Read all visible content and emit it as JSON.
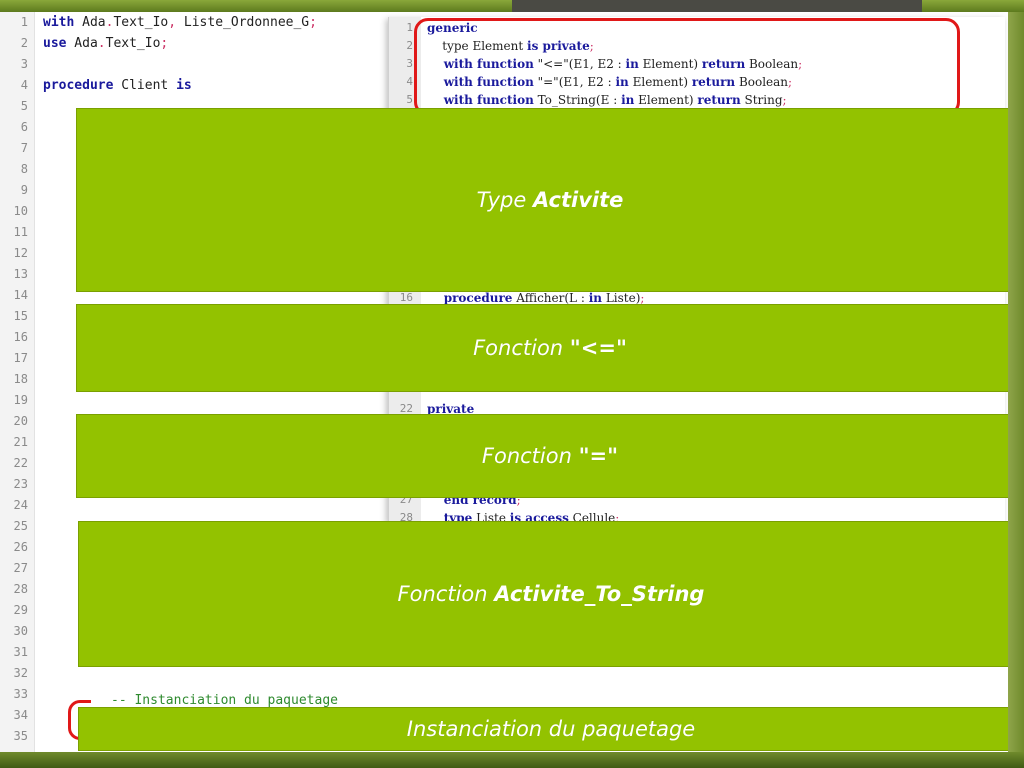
{
  "main_code": {
    "line_numbers": [
      "1",
      "2",
      "3",
      "4",
      "5",
      "6",
      "7",
      "8",
      "9",
      "10",
      "11",
      "12",
      "13",
      "14",
      "15",
      "16",
      "17",
      "18",
      "19",
      "20",
      "21",
      "22",
      "23",
      "24",
      "25",
      "26",
      "27",
      "28",
      "29",
      "30",
      "31",
      "32",
      "33",
      "34",
      "35"
    ],
    "line1_kw": "with",
    "line1_rest": " Ada",
    "line1_dot": ".",
    "line1_rest2": "Text_Io",
    "line1_comma": ",",
    "line1_rest3": " Liste_Ordonnee_G",
    "line1_semi": ";",
    "line2_kw": "use",
    "line2_rest": " Ada",
    "line2_dot": ".",
    "line2_rest2": "Text_Io",
    "line2_semi": ";",
    "line4_kw": "procedure",
    "line4_rest": " Client ",
    "line4_kw2": "is",
    "line33_comment": "-- Instanciation du paquetage"
  },
  "package_spec": {
    "line_numbers": [
      "1",
      "2",
      "3",
      "4",
      "5",
      "16",
      "22",
      "27",
      "28"
    ],
    "l1_kw": "generic",
    "l2_a": "    type Element ",
    "l2_kw": "is private",
    "l2_semi": ";",
    "l3_kw": "    with function",
    "l3_a": " \"<=\"",
    "l3_p": "(E1, E2 : ",
    "l3_in": "in",
    "l3_b": " Element) ",
    "l3_ret": "return",
    "l3_c": " Boolean",
    "l3_semi": ";",
    "l4_kw": "    with function",
    "l4_a": " \"=\"",
    "l4_p": "(E1, E2 : ",
    "l4_in": "in",
    "l4_b": " Element) ",
    "l4_ret": "return",
    "l4_c": " Boolean",
    "l4_semi": ";",
    "l5_kw": "    with function",
    "l5_a": " To_String(E : ",
    "l5_in": "in",
    "l5_b": " Element) ",
    "l5_ret": "return",
    "l5_c": " String",
    "l5_semi": ";",
    "l16_kw": "    procedure",
    "l16_a": " Afficher(L : ",
    "l16_in": "in",
    "l16_b": " Liste)",
    "l16_semi": ";",
    "l22_kw": "private",
    "l27_kw": "    end record",
    "l27_semi": ";",
    "l28_kw": "    type",
    "l28_a": " Liste ",
    "l28_kw2": "is access",
    "l28_b": " Cellule",
    "l28_semi": ";"
  },
  "overlays": {
    "type_activite_prefix": "Type ",
    "type_activite_bold": "Activite",
    "fonction_le_prefix": "Fonction ",
    "fonction_le_q1": "\"",
    "fonction_le_bold": "<=",
    "fonction_le_q2": "\"",
    "fonction_eq_prefix": "Fonction ",
    "fonction_eq_q1": "\"",
    "fonction_eq_bold": "=",
    "fonction_eq_q2": "\"",
    "fonction_ts_prefix": "Fonction ",
    "fonction_ts_bold": "Activite_To_String",
    "instanciation": "Instanciation du paquetage"
  },
  "colors": {
    "overlay_green": "#93c200",
    "highlight_red": "#e01818",
    "keyword_blue": "#1a1a9c",
    "comment_green": "#2e8a2e"
  }
}
